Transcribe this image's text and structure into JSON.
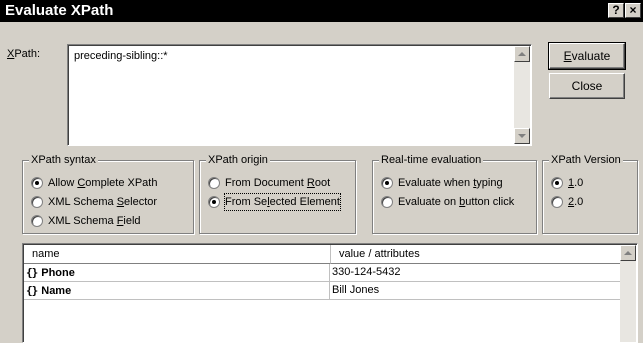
{
  "window": {
    "title": "Evaluate XPath",
    "help_glyph": "?",
    "close_glyph": "×"
  },
  "xpath": {
    "label": "XPath:",
    "label_mnemonic": "X",
    "label_rest": "Path:",
    "value": "preceding-sibling::*"
  },
  "buttons": {
    "evaluate_mnemonic": "E",
    "evaluate_rest": "valuate",
    "close_label": "Close"
  },
  "syntax_group": {
    "title": "XPath syntax",
    "options": [
      {
        "pre": "Allow ",
        "mn": "C",
        "post": "omplete XPath",
        "checked": true
      },
      {
        "pre": "XML Schema ",
        "mn": "S",
        "post": "elector",
        "checked": false
      },
      {
        "pre": "XML Schema ",
        "mn": "F",
        "post": "ield",
        "checked": false
      }
    ]
  },
  "origin_group": {
    "title": "XPath origin",
    "options": [
      {
        "pre": "From Document ",
        "mn": "R",
        "post": "oot",
        "checked": false
      },
      {
        "pre": "From Se",
        "mn": "l",
        "post": "ected Element",
        "checked": true
      }
    ]
  },
  "realtime_group": {
    "title": "Real-time evaluation",
    "options": [
      {
        "pre": "Evaluate when ",
        "mn": "t",
        "post": "yping",
        "checked": true
      },
      {
        "pre": "Evaluate on ",
        "mn": "b",
        "post": "utton click",
        "checked": false
      }
    ]
  },
  "version_group": {
    "title": "XPath Version",
    "options": [
      {
        "pre": "",
        "mn": "1",
        "post": ".0",
        "checked": true
      },
      {
        "pre": "",
        "mn": "2",
        "post": ".0",
        "checked": false
      }
    ]
  },
  "results": {
    "columns": [
      "name",
      "value / attributes"
    ],
    "node_icon": "{}",
    "rows": [
      {
        "name": "Phone",
        "value": "330-124-5432"
      },
      {
        "name": "Name",
        "value": "Bill Jones"
      }
    ]
  },
  "colors": {
    "face": "#d4d0c8",
    "titlebar": "#000000"
  }
}
